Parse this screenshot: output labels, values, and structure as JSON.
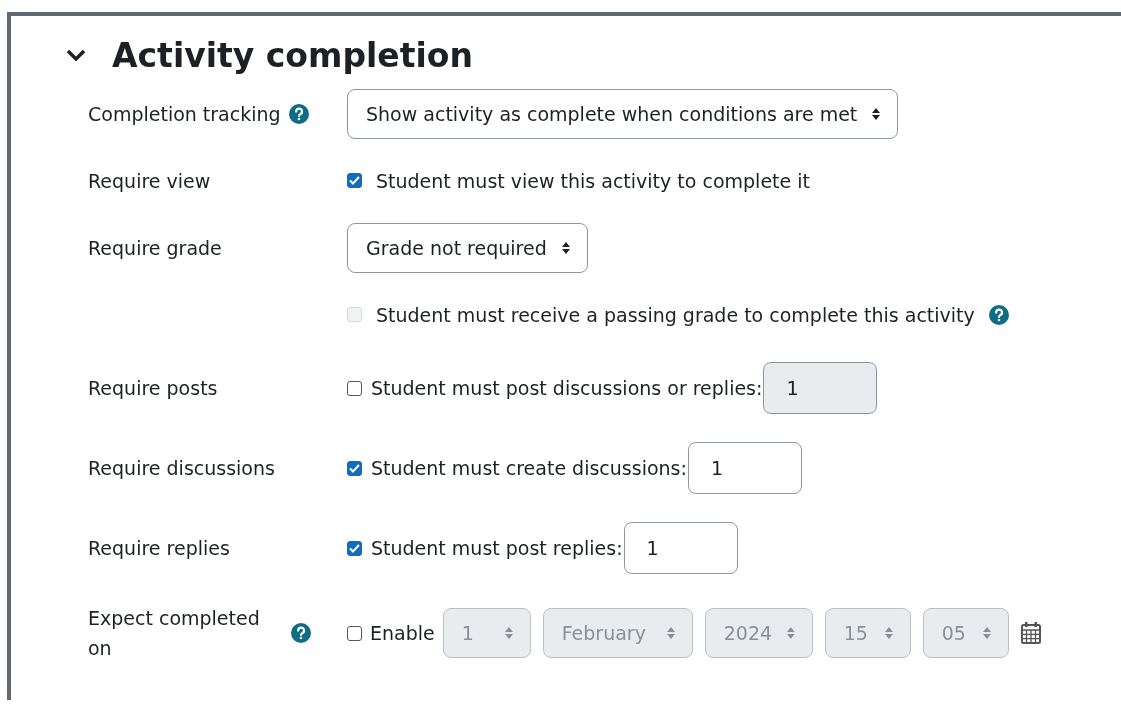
{
  "section": {
    "title": "Activity completion",
    "expanded": true
  },
  "rows": [
    {
      "kind": "select",
      "label": "Completion tracking",
      "help": true,
      "value": "Show activity as complete when conditions are met"
    },
    {
      "kind": "checkbox",
      "label": "Require view",
      "checked": true,
      "disabled": false,
      "text": "Student must view this activity to complete it"
    },
    {
      "kind": "select",
      "label": "Require grade",
      "value": "Grade not required"
    },
    {
      "kind": "checkbox",
      "checked": false,
      "disabled": true,
      "help": true,
      "text": "Student must receive a passing grade to complete this activity"
    },
    {
      "kind": "number",
      "label": "Require posts",
      "checked": false,
      "text": "Student must post discussions or replies:",
      "value": "1",
      "disabled": true
    },
    {
      "kind": "number",
      "label": "Require discussions",
      "checked": true,
      "text": "Student must create discussions:",
      "value": "1",
      "disabled": false
    },
    {
      "kind": "number",
      "label": "Require replies",
      "checked": true,
      "text": "Student must post replies:",
      "value": "1",
      "disabled": false
    },
    {
      "kind": "date",
      "label": "Expect completed on",
      "help": true,
      "checked": false,
      "text": "Enable",
      "disabled": true,
      "parts": [
        "1",
        "February",
        "2024",
        "15",
        "05"
      ]
    }
  ]
}
